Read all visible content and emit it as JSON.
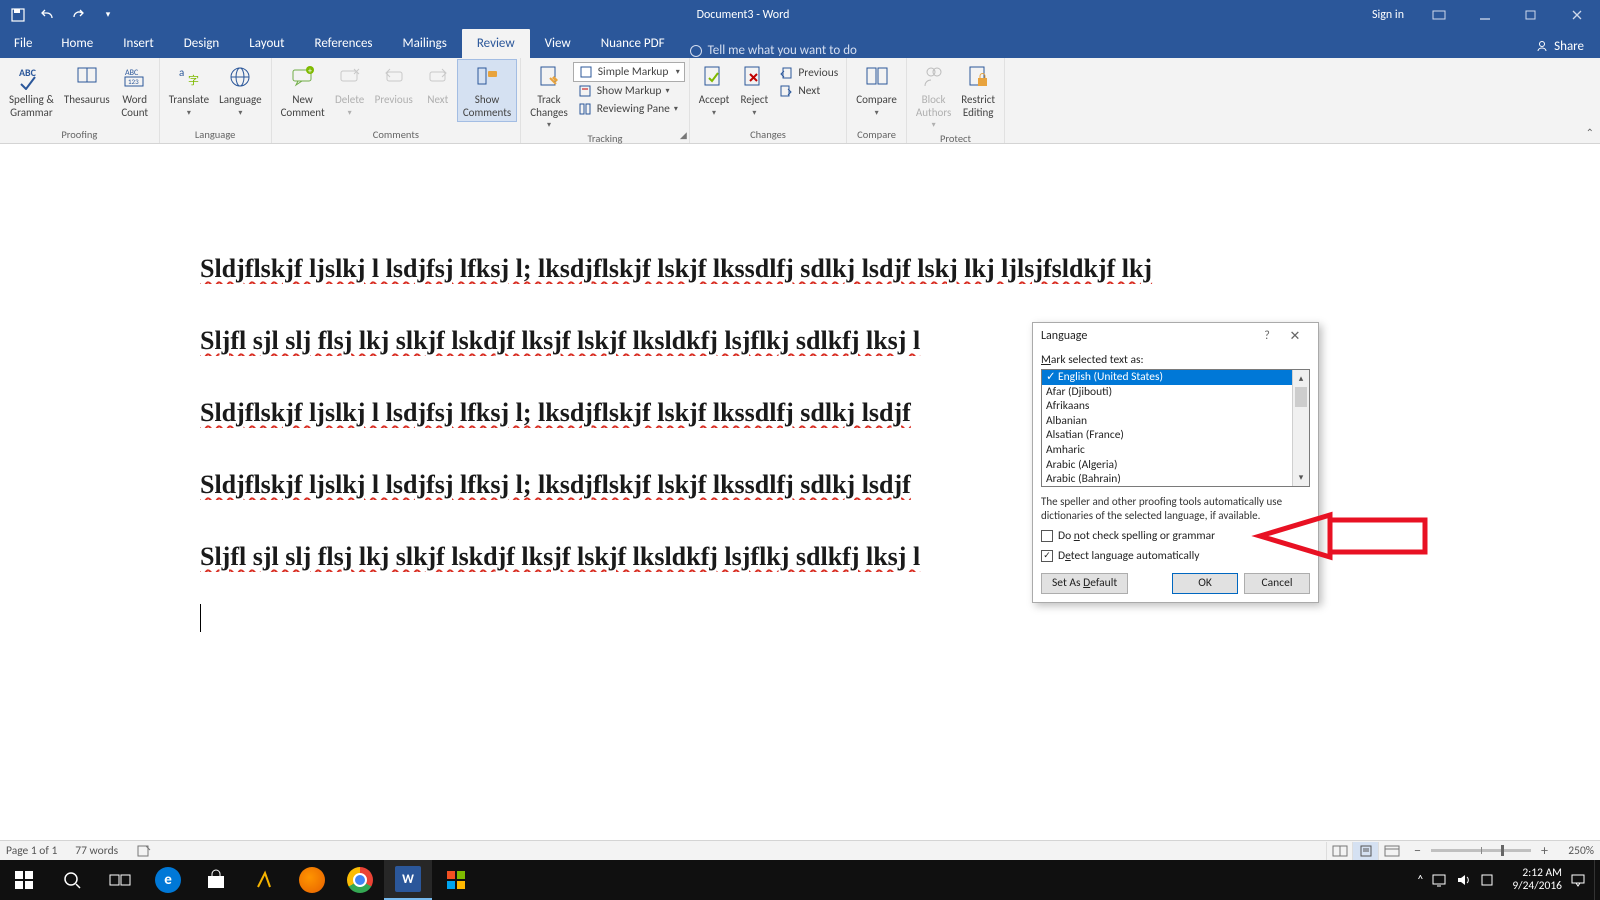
{
  "titlebar": {
    "document_title": "Document3 - Word",
    "sign_in": "Sign in"
  },
  "tabs": {
    "file": "File",
    "items": [
      "Home",
      "Insert",
      "Design",
      "Layout",
      "References",
      "Mailings",
      "Review",
      "View",
      "Nuance PDF"
    ],
    "active_index": 6,
    "tell_me": "Tell me what you want to do",
    "share": "Share"
  },
  "ribbon": {
    "groups": {
      "proofing": {
        "label": "Proofing",
        "spelling_grammar": "Spelling &\nGrammar",
        "thesaurus": "Thesaurus",
        "word_count": "Word\nCount"
      },
      "language": {
        "label": "Language",
        "translate": "Translate",
        "language": "Language"
      },
      "comments": {
        "label": "Comments",
        "new_comment": "New\nComment",
        "delete": "Delete",
        "previous": "Previous",
        "next": "Next",
        "show_comments": "Show\nComments"
      },
      "tracking": {
        "label": "Tracking",
        "track_changes": "Track\nChanges",
        "simple_markup": "Simple Markup",
        "show_markup": "Show Markup",
        "reviewing_pane": "Reviewing Pane"
      },
      "changes": {
        "label": "Changes",
        "accept": "Accept",
        "reject": "Reject",
        "previous": "Previous",
        "next": "Next"
      },
      "compare": {
        "label": "Compare",
        "compare": "Compare"
      },
      "protect": {
        "label": "Protect",
        "block_authors": "Block\nAuthors",
        "restrict_editing": "Restrict\nEditing"
      }
    }
  },
  "document": {
    "lines": [
      "Sldjflskjf ljslkj l lsdjfsj lfksj l; lksdjflskjf lskjf lkssdlfj sdlkj lsdjf lskj lkj ljlsjfsldkjf lkj",
      "Sljfl sjl slj flsj lkj slkjf lskdjf lksjf lskjf lksldkfj lsjflkj sdlkfj lksj l",
      "Sldjflskjf ljslkj l lsdjfsj lfksj l; lksdjflskjf lskjf lkssdlfj sdlkj lsdjf",
      "Sldjflskjf ljslkj l lsdjfsj lfksj l; lksdjflskjf lskjf lkssdlfj sdlkj lsdjf",
      "Sljfl sjl slj flsj lkj slkjf lskdjf lksjf lskjf lksldkfj lsjflkj sdlkfj lksj l"
    ]
  },
  "dialog": {
    "title": "Language",
    "mark_label": "Mark selected text as:",
    "languages": [
      "English (United States)",
      "Afar (Djibouti)",
      "Afrikaans",
      "Albanian",
      "Alsatian (France)",
      "Amharic",
      "Arabic (Algeria)",
      "Arabic (Bahrain)"
    ],
    "selected_index": 0,
    "hint": "The speller and other proofing tools automatically use dictionaries of the selected language, if available.",
    "chk_do_not": "Do not check spelling or grammar",
    "chk_do_not_checked": false,
    "chk_detect": "Detect language automatically",
    "chk_detect_checked": true,
    "set_default": "Set As Default",
    "ok": "OK",
    "cancel": "Cancel"
  },
  "statusbar": {
    "page": "Page 1 of 1",
    "words": "77 words",
    "zoom": "250%"
  },
  "system": {
    "time": "2:12 AM",
    "date": "9/24/2016"
  }
}
